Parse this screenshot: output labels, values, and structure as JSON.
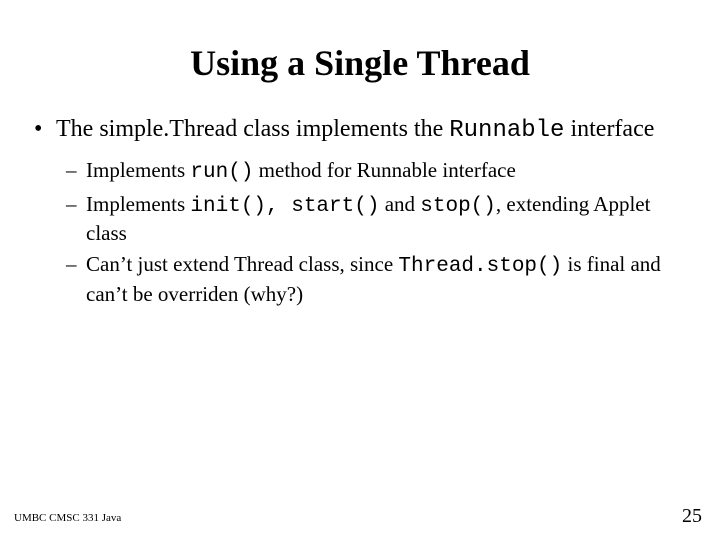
{
  "title": "Using a Single Thread",
  "bullet": {
    "pre": "The simple.Thread class implements the ",
    "code": "Runnable",
    "post": " interface"
  },
  "sub1": {
    "pre": "Implements ",
    "code": "run()",
    "post": " method for Runnable interface"
  },
  "sub2": {
    "pre": "Implements ",
    "code1": "init(), start()",
    "mid": " and ",
    "code2": "stop()",
    "post": ", extending Applet class"
  },
  "sub3": {
    "pre": "Can’t just extend Thread class, since ",
    "code": "Thread.stop()",
    "post": " is final and can’t be overriden (why?)"
  },
  "footer_left": "UMBC CMSC 331 Java",
  "page_number": "25"
}
